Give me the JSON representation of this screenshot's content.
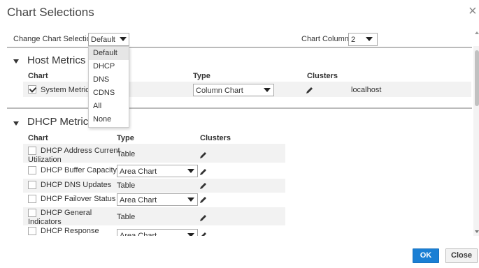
{
  "dialog": {
    "title": "Chart Selections",
    "close_icon": "close-icon"
  },
  "toolbar": {
    "chart_selection_label": "Change Chart Selection",
    "chart_selection_value": "Default",
    "chart_columns_label": "Chart Columns",
    "chart_columns_value": "2"
  },
  "dropdown": {
    "options": [
      "Default",
      "DHCP",
      "DNS",
      "CDNS",
      "All",
      "None"
    ],
    "selected": "Default"
  },
  "host_metrics": {
    "title": "Host Metrics",
    "headers": {
      "chart": "Chart",
      "type": "Type",
      "clusters": "Clusters"
    },
    "rows": [
      {
        "chart": "System Metrics",
        "checked": true,
        "type": "Column Chart",
        "cluster": "localhost"
      }
    ]
  },
  "dhcp_metrics": {
    "title": "DHCP Metrics",
    "headers": {
      "chart": "Chart",
      "type": "Type",
      "clusters": "Clusters"
    },
    "rows": [
      {
        "chart_line1": "DHCP Address Current",
        "chart_line2": "Utilization",
        "type": "Table"
      },
      {
        "chart_line1": "DHCP Buffer Capacity",
        "chart_line2": "",
        "type": "Area Chart"
      },
      {
        "chart_line1": "DHCP DNS Updates",
        "chart_line2": "",
        "type": "Table"
      },
      {
        "chart_line1": "DHCP Failover Status",
        "chart_line2": "",
        "type": "Area Chart"
      },
      {
        "chart_line1": "DHCP General",
        "chart_line2": "Indicators",
        "type": "Table"
      },
      {
        "chart_line1": "DHCP Response",
        "chart_line2": "",
        "type": "Area Chart"
      }
    ]
  },
  "buttons": {
    "ok": "OK",
    "close": "Close"
  },
  "colors": {
    "primary": "#1a7fd4",
    "row_alt": "#f2f2f2"
  }
}
